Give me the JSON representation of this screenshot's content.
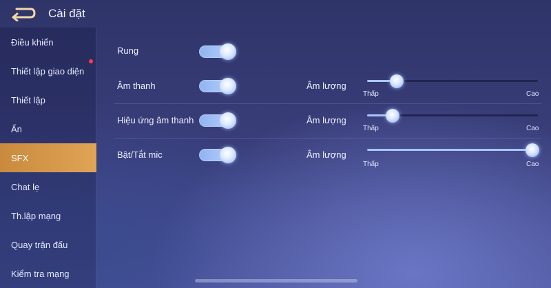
{
  "header": {
    "title": "Cài đặt"
  },
  "sidebar": {
    "items": [
      {
        "label": "Điều khiển"
      },
      {
        "label": "Thiết lập giao diện"
      },
      {
        "label": "Thiết lập"
      },
      {
        "label": "Ẩn"
      },
      {
        "label": "SFX"
      },
      {
        "label": "Chat lẹ"
      },
      {
        "label": "Th.lập mạng"
      },
      {
        "label": "Quay trận đấu"
      },
      {
        "label": "Kiểm tra mạng"
      }
    ],
    "active_index": 4,
    "notification_item_index": 1
  },
  "settings": {
    "rows": [
      {
        "label": "Rung",
        "toggle_on": true
      },
      {
        "label": "Âm thanh",
        "toggle_on": true,
        "volume_label": "Âm lượng",
        "volume": 0.06,
        "low_label": "Thấp",
        "high_label": "Cao"
      },
      {
        "label": "Hiệu ứng âm thanh",
        "toggle_on": true,
        "volume_label": "Âm lượng",
        "volume": 0.03,
        "low_label": "Thấp",
        "high_label": "Cao"
      },
      {
        "label": "Bật/Tắt mic",
        "toggle_on": true,
        "volume_label": "Âm lượng",
        "volume": 1.0,
        "low_label": "Thấp",
        "high_label": "Cao"
      }
    ]
  },
  "colors": {
    "active_tab": "#d4974a",
    "notification_dot": "#ff3b4a",
    "slider_fill": "#a9c6ff"
  }
}
